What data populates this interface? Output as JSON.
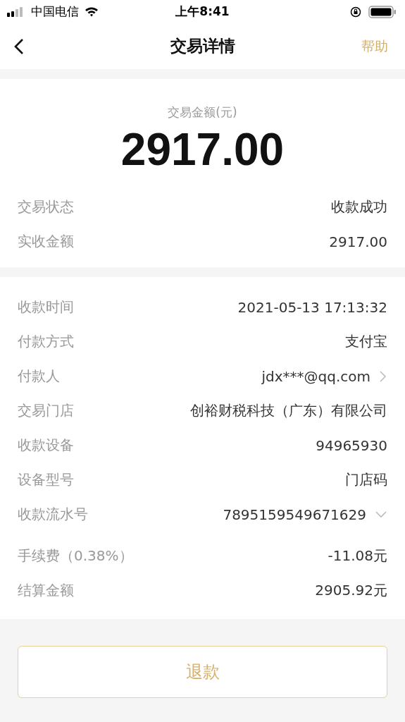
{
  "status_bar": {
    "carrier": "中国电信",
    "time": "上午8:41"
  },
  "nav": {
    "title": "交易详情",
    "help": "帮助"
  },
  "summary": {
    "label": "交易金额(元)",
    "amount": "2917.00",
    "rows": [
      {
        "label": "交易状态",
        "value": "收款成功",
        "kind": "plain"
      },
      {
        "label": "实收金额",
        "value": "2917.00",
        "kind": "plain"
      }
    ]
  },
  "details": [
    {
      "label": "收款时间",
      "value": "2021-05-13 17:13:32",
      "kind": "plain"
    },
    {
      "label": "付款方式",
      "value": "支付宝",
      "kind": "plain"
    },
    {
      "label": "付款人",
      "value": "jdx***@qq.com",
      "kind": "link"
    },
    {
      "label": "交易门店",
      "value": "创裕财税科技（广东）有限公司",
      "kind": "plain"
    },
    {
      "label": "收款设备",
      "value": "94965930",
      "kind": "plain"
    },
    {
      "label": "设备型号",
      "value": "门店码",
      "kind": "plain"
    },
    {
      "label": "收款流水号",
      "value": "7895159549671629",
      "kind": "expand",
      "expanded": false
    }
  ],
  "fees": [
    {
      "label": "手续费（0.38%）",
      "value": "-11.08元",
      "kind": "plain"
    },
    {
      "label": "结算金额",
      "value": "2905.92元",
      "kind": "plain"
    }
  ],
  "refund_button": "退款"
}
